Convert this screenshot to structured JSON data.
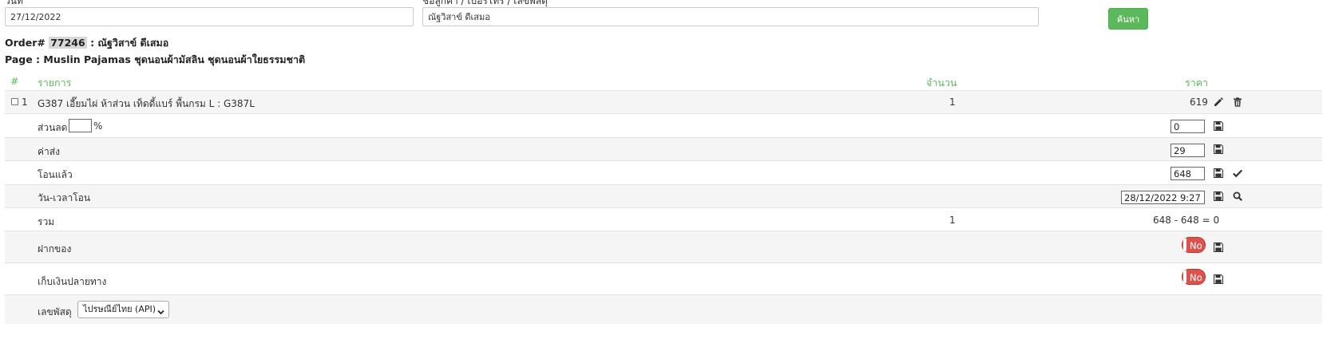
{
  "search": {
    "date_label": "วันที่",
    "date_value": "27/12/2022",
    "customer_label": "ชื่อลูกค้า / เบอร์โทร / เลขพัสดุ",
    "customer_value": "ณัฐวิสาข์ ดีเสมอ",
    "search_button": "ค้นหา"
  },
  "order": {
    "prefix": "Order#",
    "number": "77246",
    "customer": ": ณัฐวิสาข์ ดีเสมอ",
    "page_line": "Page : Muslin Pajamas ชุดนอนผ้ามัสลิน ชุดนอนผ้าใยธรรมชาติ"
  },
  "table": {
    "headers": {
      "index": "#",
      "item": "รายการ",
      "qty": "จำนวน",
      "price": "ราคา"
    },
    "item": {
      "index": "1",
      "name": "G387 เอี๊ยมไผ่ ห้าส่วน เท็ดดี้แบร์ พื้นกรม L : G387L",
      "qty": "1",
      "price": "619"
    },
    "discount": {
      "label": "ส่วนลด",
      "percent_value": "",
      "percent_symbol": "%",
      "value": "0"
    },
    "shipping": {
      "label": "ค่าส่ง",
      "value": "29"
    },
    "transferred": {
      "label": "โอนแล้ว",
      "value": "648"
    },
    "transfer_datetime": {
      "label": "วัน-เวลาโอน",
      "value": "28/12/2022 9:27"
    },
    "total": {
      "label": "รวม",
      "qty": "1",
      "value": "648 - 648 = 0"
    },
    "deposit": {
      "label": "ฝากของ",
      "toggle": "No"
    },
    "cod": {
      "label": "เก็บเงินปลายทาง",
      "toggle": "No"
    },
    "tracking": {
      "label": "เลขพัสดุ",
      "carrier": "ไปรษณีย์ไทย (API)"
    }
  },
  "colors": {
    "accent": "#5cb85c",
    "danger": "#d9534f",
    "row_alt": "#f5f5f5"
  },
  "icons": {
    "edit": "pencil-icon",
    "delete": "trash-icon",
    "save": "floppy-disk-icon",
    "confirm": "check-icon",
    "lookup": "search-icon",
    "dropdown": "chevron-down-icon"
  }
}
